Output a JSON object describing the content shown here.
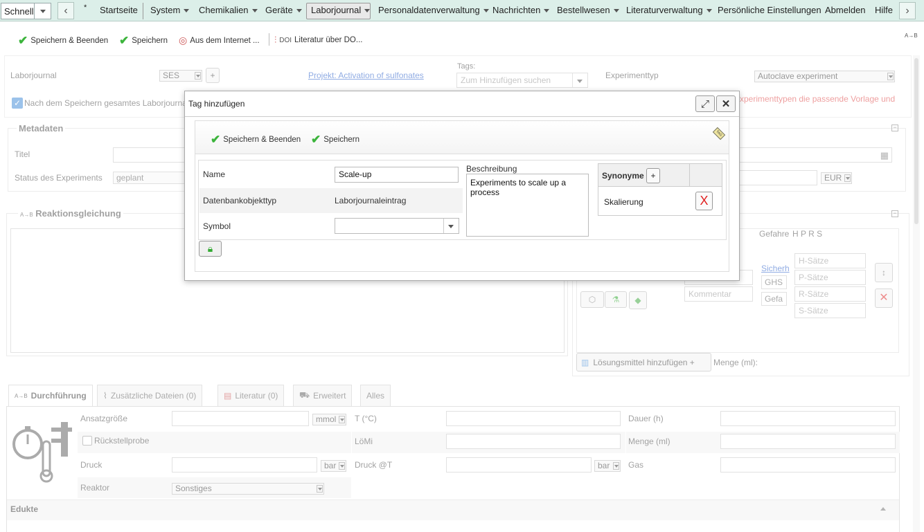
{
  "menubar": {
    "quick_label": "Schnell",
    "star": "*",
    "items": [
      "Startseite",
      "System",
      "Chemikalien",
      "Geräte",
      "Laborjournal",
      "Personaldatenverwaltung",
      "Nachrichten",
      "Bestellwesen",
      "Literaturverwaltung",
      "Persönliche Einstellungen",
      "Abmelden",
      "Hilfe"
    ]
  },
  "toolbar": {
    "save_close": "Speichern & Beenden",
    "save": "Speichern",
    "from_internet": "Aus dem Internet ...",
    "doi_prefix": "DOI",
    "literature_doi": "Literatur über DO...",
    "corner": "A→B"
  },
  "form": {
    "laborjournal_label": "Laborjournal",
    "laborjournal_value": "SES",
    "plus": "+",
    "project_link": "Projekt: Activation of sulfonates",
    "tags_label": "Tags:",
    "tags_placeholder": "Zum Hinzufügen suchen",
    "experimenttyp_label": "Experimenttyp",
    "experimenttyp_value": "Autoclave experiment",
    "after_save_text": "Nach dem Speichern gesamtes Laborjourna",
    "red_notice": "xperimenttypen die passende Vorlage und",
    "metadaten_title": "Metadaten",
    "titel_label": "Titel",
    "status_label": "Status des Experiments",
    "status_value": "geplant",
    "currency": "EUR",
    "reaction_prefix": "A→B",
    "reaction_title": "Reaktionsgleichung",
    "gefahren_header": "Gefahre",
    "hprs_header": "H P R S",
    "sicherheit_link": "Sicherh",
    "ghs": "GHS",
    "gefa": "Gefa",
    "kommentar_placeholder": "Kommentar",
    "h_saetze": "H-Sätze",
    "p_saetze": "P-Sätze",
    "r_saetze": "R-Sätze",
    "s_saetze": "S-Sätze",
    "solvent_button": "Lösungsmittel hinzufügen +",
    "menge_ml": "Menge (ml):"
  },
  "tabs": {
    "durchfuehrung_prefix": "A→B",
    "durchfuehrung": "Durchführung",
    "zusaetzliche": "Zusätzliche Dateien (0)",
    "literatur": "Literatur (0)",
    "erweitert": "Erweitert",
    "alles": "Alles"
  },
  "procedure": {
    "ansatzgroesse": "Ansatzgröße",
    "ansatz_unit": "mmol",
    "temperatur": "T (°C)",
    "dauer": "Dauer (h)",
    "rueckstellprobe": "Rückstellprobe",
    "loemi": "LöMi",
    "menge": "Menge (ml)",
    "druck": "Druck",
    "druck_unit": "bar",
    "druck_at": "Druck @T",
    "druck_at_unit": "bar",
    "gas": "Gas",
    "reaktor": "Reaktor",
    "reaktor_value": "Sonstiges",
    "edukte": "Edukte"
  },
  "dialog": {
    "title": "Tag hinzufügen",
    "save_close": "Speichern & Beenden",
    "save": "Speichern",
    "name_label": "Name",
    "name_value": "Scale-up",
    "dbtype_label": "Datenbankobjekttyp",
    "dbtype_value": "Laborjournaleintrag",
    "symbol_label": "Symbol",
    "symbol_value": "",
    "beschreibung_label": "Beschreibung",
    "beschreibung_value": "Experiments to scale up a process",
    "synonyme_header": "Synonyme",
    "synonyme_add": "+",
    "synonym_1": "Skalierung",
    "remove_glyph": "X",
    "tag_icon_text": "TAG"
  }
}
